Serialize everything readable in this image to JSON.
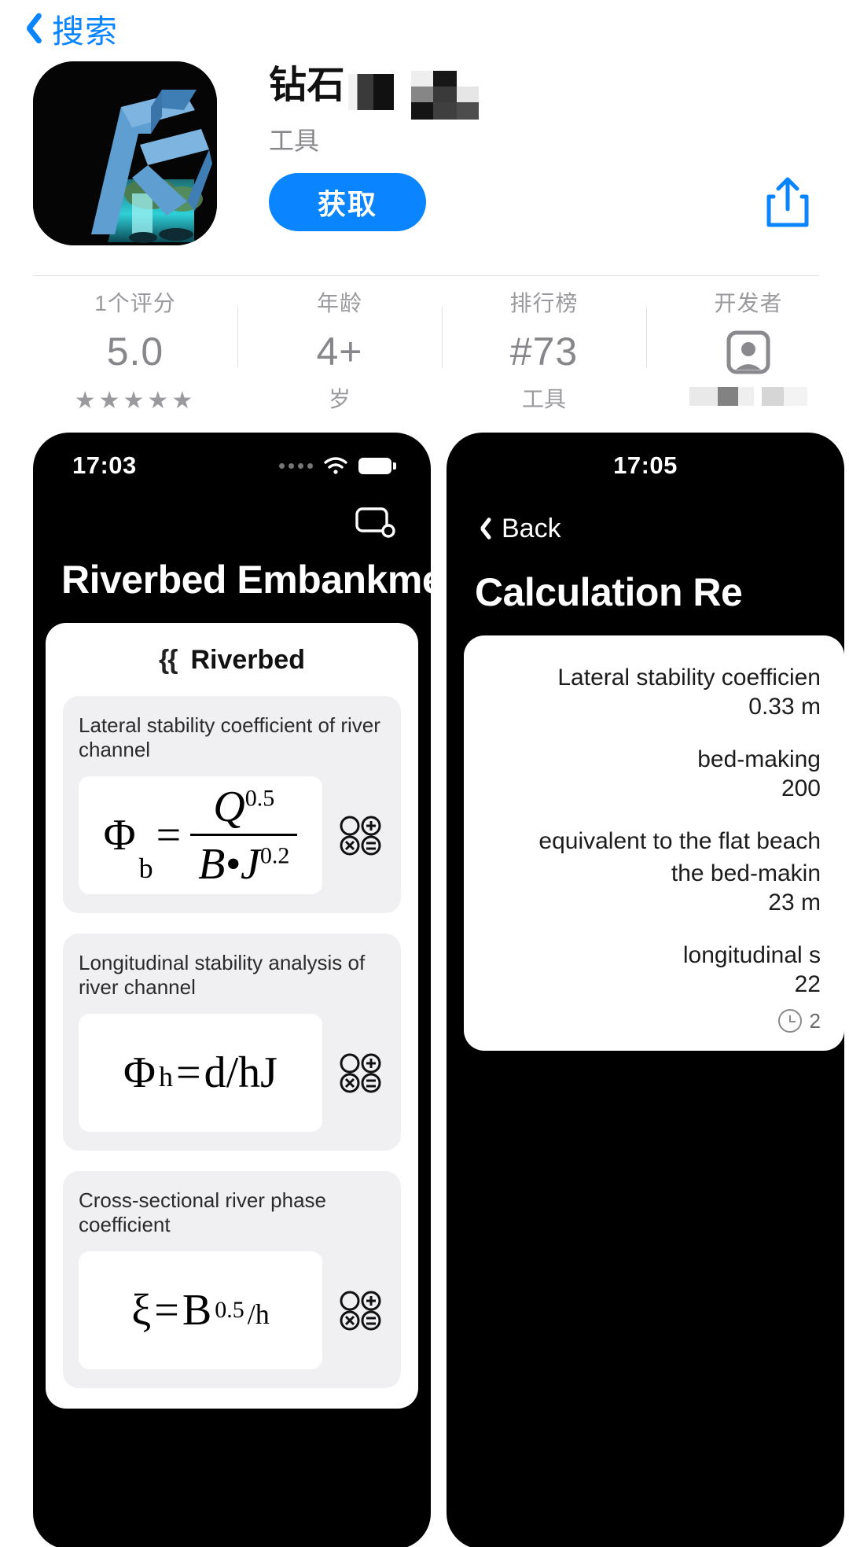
{
  "nav": {
    "back_label": "搜索",
    "back_icon": "chevron-left-icon"
  },
  "app": {
    "title": "钻石",
    "title_censored": true,
    "subtitle": "工具",
    "get_label": "获取",
    "share_icon": "share-icon",
    "icon_name": "app-icon-blue-waterfall"
  },
  "stats": [
    {
      "label": "1个评分",
      "value": "5.0",
      "sub": "★★★★★",
      "kind": "rating"
    },
    {
      "label": "年龄",
      "value": "4+",
      "sub": "岁",
      "kind": "age"
    },
    {
      "label": "排行榜",
      "value": "#73",
      "sub": "工具",
      "kind": "rank"
    },
    {
      "label": "开发者",
      "value": "",
      "sub": "",
      "kind": "developer"
    }
  ],
  "screenshots": [
    {
      "status_time": "17:03",
      "title": "Riverbed Embankment",
      "sheet_header": "Riverbed",
      "sheet_header_icon": "river-squiggle-icon",
      "toolbar_icon": "card-stack-icon",
      "formulas": [
        {
          "caption": "Lateral stability coefficient of river channel",
          "lhs": "Φ",
          "lhs_sub": "b",
          "eq": "=",
          "numerator": "Q",
          "numerator_sup": "0.5",
          "denominator": "B•J",
          "denominator_sup": "0.2",
          "is_fraction": true,
          "action_icon": "calculator-icon"
        },
        {
          "caption": "Longitudinal stability analysis of river channel",
          "lhs": "Φ",
          "lhs_sub": "h",
          "eq": "=",
          "inline": "d/hJ",
          "is_fraction": false,
          "action_icon": "calculator-icon"
        },
        {
          "caption": "Cross-sectional river phase coefficient",
          "lhs": "ξ",
          "lhs_sub": "",
          "eq": "=",
          "inline": "B",
          "inline_sup": "0.5",
          "inline_tail": "/h",
          "is_fraction": false,
          "action_icon": "calculator-icon"
        }
      ]
    },
    {
      "status_time": "17:05",
      "back_label": "Back",
      "back_icon": "chevron-left-icon",
      "title": "Calculation Re",
      "results": [
        {
          "label": "Lateral stability coefficien",
          "value": "0.33 m"
        },
        {
          "label": "bed-making",
          "value": "200"
        },
        {
          "label": "equivalent to the flat beach\nthe bed-makin",
          "value": "23 m"
        },
        {
          "label": "longitudinal s",
          "value": "22"
        }
      ],
      "footer_icon": "clock-icon",
      "footer_text": "2"
    }
  ]
}
